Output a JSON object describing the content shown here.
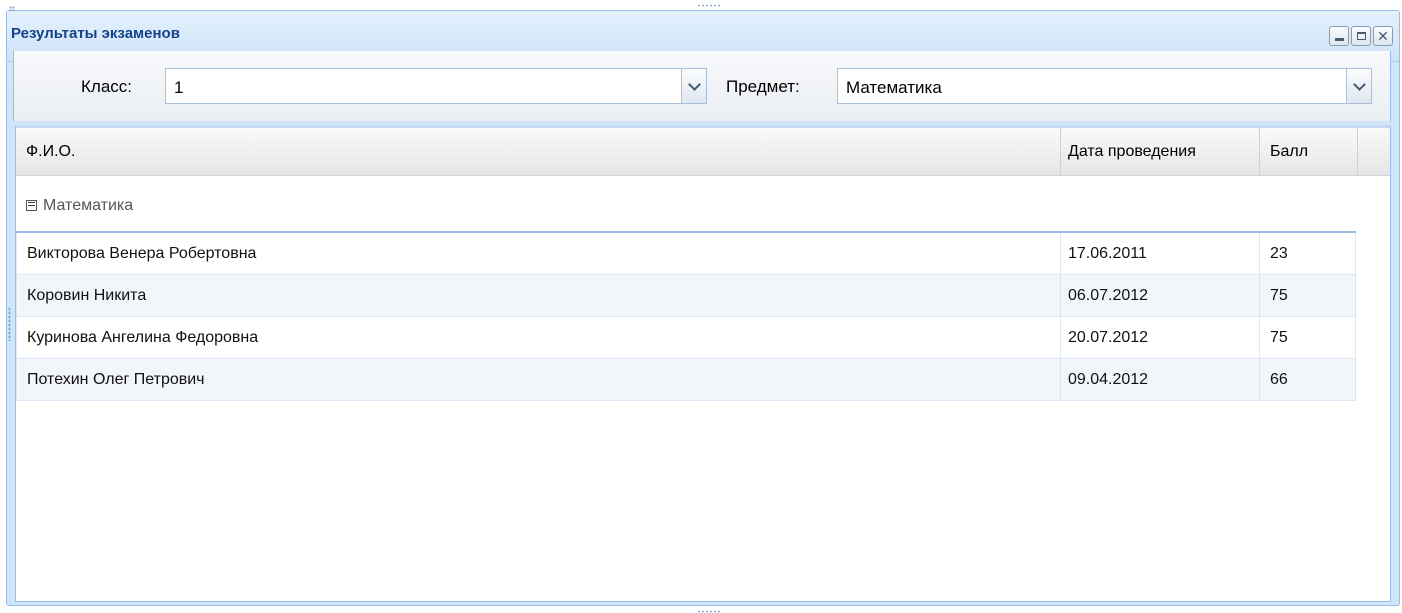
{
  "window": {
    "title": "Результаты экзаменов"
  },
  "filters": {
    "class_label": "Класс:",
    "class_value": "1",
    "subject_label": "Предмет:",
    "subject_value": "Математика"
  },
  "grid": {
    "columns": [
      "Ф.И.О.",
      "Дата проведения",
      "Балл"
    ],
    "group_label": "Математика",
    "rows": [
      {
        "name": "Викторова Венера Робертовна",
        "date": "17.06.2011",
        "score": "23"
      },
      {
        "name": "Коровин Никита",
        "date": "06.07.2012",
        "score": "75"
      },
      {
        "name": "Куринова Ангелина Федоровна",
        "date": "20.07.2012",
        "score": "75"
      },
      {
        "name": "Потехин Олег Петрович",
        "date": "09.04.2012",
        "score": "66"
      }
    ]
  },
  "colors": {
    "title_text": "#15428b",
    "border": "#99bbe8",
    "alt_row": "#f2f5f9"
  }
}
